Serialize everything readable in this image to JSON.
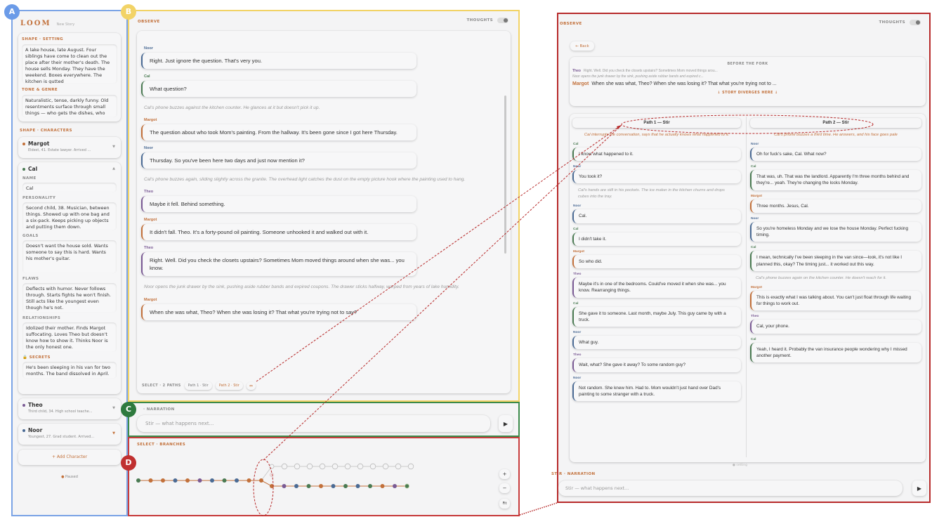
{
  "badges": {
    "a": "A",
    "b": "B",
    "c": "C",
    "d": "D"
  },
  "colors": {
    "margot": "#c2703a",
    "cal": "#4a7a52",
    "noor": "#4a6a94",
    "theo": "#7a5a94",
    "accent": "#c2703a"
  },
  "sidebar": {
    "logo": "LOOM",
    "story": "New Story",
    "setting_label": "SHAPE · SETTING",
    "setting_text": "A lake house, late August. Four siblings have come to clean out the place after their mother's death. The house sells Monday. They have the weekend. Boxes everywhere. The kitchen is gutted",
    "tone_label": "TONE & GENRE",
    "tone_text": "Naturalistic, tense, darkly funny. Old resentments surface through small things — who gets the dishes, who",
    "chars_label": "SHAPE · CHARACTERS",
    "margot": {
      "name": "Margot",
      "sub": "Eldest, 41. Estate lawyer. Arrived ..."
    },
    "cal": {
      "name": "Cal",
      "name_label": "NAME",
      "name_value": "Cal",
      "personality_label": "PERSONALITY",
      "personality": "Second child, 38. Musician, between things. Showed up with one bag and a six-pack. Keeps picking up objects and putting them down.",
      "goals_label": "GOALS",
      "goals": "Doesn't want the house sold. Wants someone to say this is hard. Wants his mother's guitar.",
      "flaws_label": "FLAWS",
      "flaws": "Deflects with humor. Never follows through. Starts fights he won't finish. Still acts like the youngest even though he's not.",
      "rel_label": "RELATIONSHIPS",
      "rel": "Idolized their mother. Finds Margot suffocating. Loves Theo but doesn't know how to show it. Thinks Noor is the only honest one.",
      "secrets_label": "SECRETS",
      "secrets": "He's been sleeping in his van for two months. The band dissolved in April."
    },
    "theo": {
      "name": "Theo",
      "sub": "Third child, 34. High school teache..."
    },
    "noor": {
      "name": "Noor",
      "sub": "Youngest, 27. Grad student. Arrived..."
    },
    "add": "+ Add Character",
    "status": "Paused"
  },
  "observe": {
    "label": "OBSERVE",
    "thoughts": "THOUGHTS",
    "messages": [
      {
        "k": "d",
        "speaker": "Noor",
        "c": "noor",
        "text": "Right. Just ignore the question. That's very you."
      },
      {
        "k": "d",
        "speaker": "Cal",
        "c": "cal",
        "text": "What question?"
      },
      {
        "k": "n",
        "text": "Cal's phone buzzes against the kitchen counter. He glances at it but doesn't pick it up."
      },
      {
        "k": "d",
        "speaker": "Margot",
        "c": "margot",
        "text": "The question about who took Mom's painting. From the hallway. It's been gone since I got here Thursday."
      },
      {
        "k": "d",
        "speaker": "Noor",
        "c": "noor",
        "text": "Thursday. So you've been here two days and just now mention it?"
      },
      {
        "k": "n",
        "text": "Cal's phone buzzes again, sliding slightly across the granite. The overhead light catches the dust on the empty picture hook where the painting used to hang."
      },
      {
        "k": "d",
        "speaker": "Theo",
        "c": "theo",
        "text": "Maybe it fell. Behind something."
      },
      {
        "k": "d",
        "speaker": "Margot",
        "c": "margot",
        "text": "It didn't fall. Theo. It's a forty-pound oil painting. Someone unhooked it and walked out with it."
      },
      {
        "k": "d",
        "speaker": "Theo",
        "c": "theo",
        "text": "Right. Well. Did you check the closets upstairs? Sometimes Mom moved things around when she was... you know."
      },
      {
        "k": "n",
        "text": "Noor opens the junk drawer by the sink, pushing aside rubber bands and expired coupons. The drawer sticks halfway, warped from years of lake humidity."
      },
      {
        "k": "d",
        "speaker": "Margot",
        "c": "margot",
        "text": "When she was what, Theo? When she was losing it? That what you're trying not to say?"
      }
    ],
    "select": "SELECT · 2 PATHS",
    "path1": "Path 1 · Stir",
    "path2": "Path 2 · Stir",
    "swap": "⇔",
    "setting": "● setting"
  },
  "narration": {
    "label": "· NARRATION",
    "placeholder": "Stir — what happens next...",
    "send": "▶"
  },
  "branches": {
    "label": "SELECT · BRANCHES",
    "zin": "+",
    "zout": "−",
    "fit": "Fit"
  },
  "right": {
    "label": "OBSERVE",
    "thoughts": "THOUGHTS",
    "back": "← Back",
    "before": "BEFORE THE FORK",
    "ctx": [
      {
        "speaker": "Theo",
        "text": "Right. Well. Did you check the closets upstairs? Sometimes Mom moved things arou..."
      },
      {
        "speaker": "",
        "text": "Noor opens the junk drawer by the sink, pushing aside rubber bands and expired c..."
      },
      {
        "speaker": "Margot",
        "text": "When she was what, Theo? When she was losing it? That what you're trying not to ..."
      }
    ],
    "diverge": "↓ STORY DIVERGES HERE ↓",
    "p1": {
      "title": "Path 1 — Stir",
      "intro": "Cal interrupts the conversation, says that he actually knows what happened to it.",
      "messages": [
        {
          "k": "d",
          "speaker": "Cal",
          "c": "cal",
          "text": "I know what happened to it."
        },
        {
          "k": "d",
          "speaker": "Noor",
          "c": "noor",
          "text": "You took it?"
        },
        {
          "k": "n",
          "text": "Cal's hands are still in his pockets. The ice maker in the kitchen churns and drops cubes into the tray."
        },
        {
          "k": "d",
          "speaker": "Noor",
          "c": "noor",
          "text": "Cal."
        },
        {
          "k": "d",
          "speaker": "Cal",
          "c": "cal",
          "text": "I didn't take it."
        },
        {
          "k": "d",
          "speaker": "Margot",
          "c": "margot",
          "text": "So who did."
        },
        {
          "k": "d",
          "speaker": "Theo",
          "c": "theo",
          "text": "Maybe it's in one of the bedrooms. Could've moved it when she was... you know. Rearranging things."
        },
        {
          "k": "d",
          "speaker": "Cal",
          "c": "cal",
          "text": "She gave it to someone. Last month, maybe July. This guy came by with a truck."
        },
        {
          "k": "d",
          "speaker": "Noor",
          "c": "noor",
          "text": "What guy."
        },
        {
          "k": "d",
          "speaker": "Theo",
          "c": "theo",
          "text": "Wait, what? She gave it away? To some random guy?"
        },
        {
          "k": "d",
          "speaker": "Noor",
          "c": "noor",
          "text": "Not random. She knew him. Had to. Mom wouldn't just hand over Dad's painting to some stranger with a truck."
        }
      ]
    },
    "p2": {
      "title": "Path 2 — Stir",
      "intro": "Cal's phone buzzes a third time. He answers, and his face goes pale",
      "messages": [
        {
          "k": "d",
          "speaker": "Noor",
          "c": "noor",
          "text": "Oh for fuck's sake, Cal. What now?"
        },
        {
          "k": "d",
          "speaker": "Cal",
          "c": "cal",
          "text": "That was, uh. That was the landlord. Apparently I'm three months behind and they're... yeah. They're changing the locks Monday."
        },
        {
          "k": "d",
          "speaker": "Margot",
          "c": "margot",
          "text": "Three months. Jesus, Cal."
        },
        {
          "k": "d",
          "speaker": "Noor",
          "c": "noor",
          "text": "So you're homeless Monday and we lose the house Monday. Perfect fucking timing."
        },
        {
          "k": "d",
          "speaker": "Cal",
          "c": "cal",
          "text": "I mean, technically I've been sleeping in the van since—look, it's not like I planned this, okay? The timing just... it worked out this way."
        },
        {
          "k": "n",
          "text": "Cal's phone buzzes again on the kitchen counter. He doesn't reach for it."
        },
        {
          "k": "d",
          "speaker": "Margot",
          "c": "margot",
          "text": "This is exactly what I was talking about. You can't just float through life waiting for things to work out."
        },
        {
          "k": "d",
          "speaker": "Theo",
          "c": "theo",
          "text": "Cal, your phone."
        },
        {
          "k": "d",
          "speaker": "Cal",
          "c": "cal",
          "text": "Yeah, I heard it. Probably the van insurance people wondering why I missed another payment."
        }
      ]
    },
    "setting": "● setting",
    "narr_label": "STIR · NARRATION",
    "placeholder": "Stir — what happens next...",
    "send": "▶"
  }
}
